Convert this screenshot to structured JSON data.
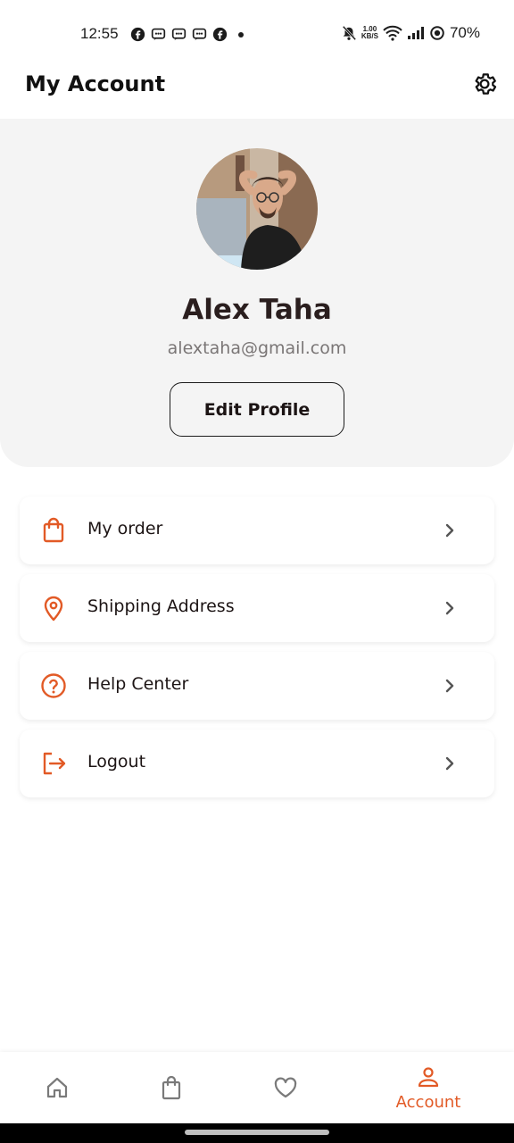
{
  "status_bar": {
    "time": "12:55",
    "speed_value": "1.00",
    "speed_unit": "KB/S",
    "battery": "70%",
    "notification_icons": [
      "facebook-icon",
      "messenger-icon",
      "messenger-icon",
      "messenger-icon",
      "facebook-icon"
    ]
  },
  "header": {
    "title": "My Account"
  },
  "profile": {
    "name": "Alex Taha",
    "email": "alextaha@gmail.com",
    "edit_label": "Edit Profile"
  },
  "menu": {
    "items": [
      {
        "label": "My order",
        "icon": "shopping-bag-icon"
      },
      {
        "label": "Shipping Address",
        "icon": "location-pin-icon"
      },
      {
        "label": "Help Center",
        "icon": "help-circle-icon"
      },
      {
        "label": "Logout",
        "icon": "logout-icon"
      }
    ]
  },
  "bottom_nav": {
    "active_label": "Account",
    "items": [
      "home-icon",
      "bag-icon",
      "heart-icon",
      "account-icon"
    ]
  },
  "colors": {
    "accent": "#e25a26",
    "profile_bg": "#f4f4f4",
    "text": "#1c1414"
  }
}
